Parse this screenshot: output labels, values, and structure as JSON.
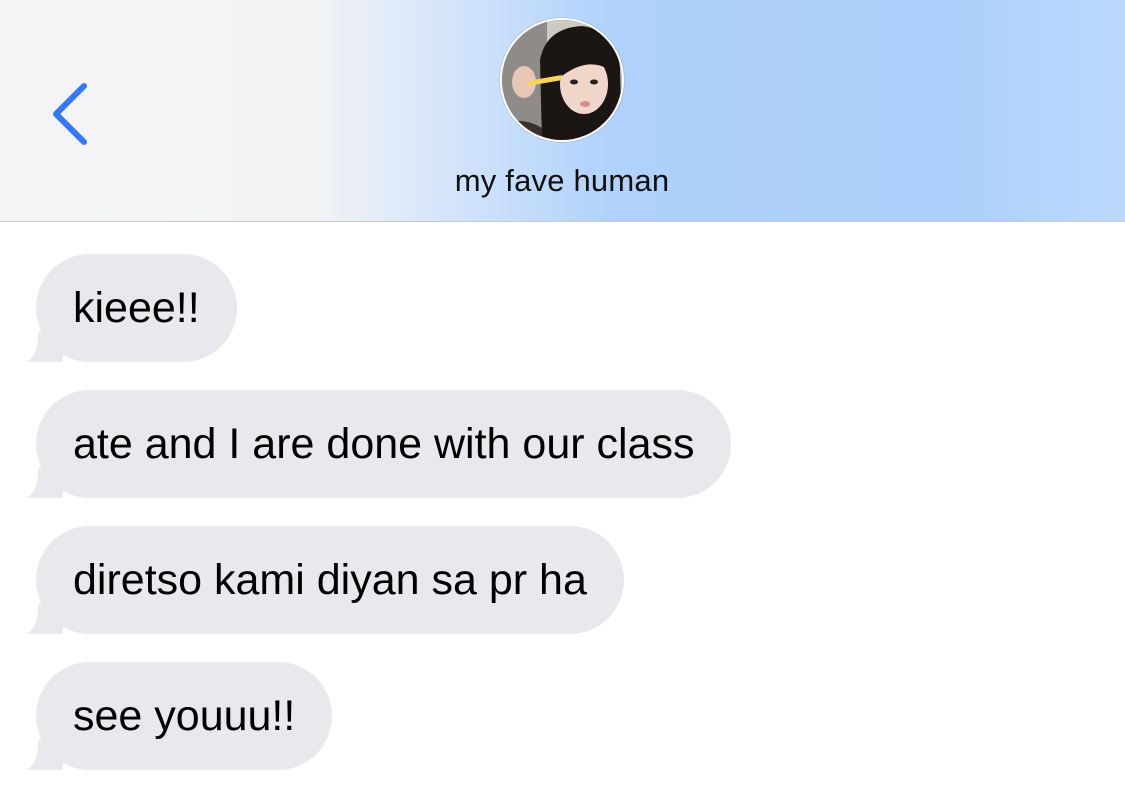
{
  "header": {
    "back_icon": "chevron-left-icon",
    "contact_name": "my fave human",
    "accent_color": "#3478f6"
  },
  "messages": [
    {
      "text": "kieee!!"
    },
    {
      "text": "ate and I are done with our class"
    },
    {
      "text": "diretso kami diyan sa pr ha"
    },
    {
      "text": "see youuu!!"
    }
  ],
  "colors": {
    "incoming_bubble": "#e8e8ed",
    "header_gradient_start": "#f4f4f6",
    "header_gradient_end": "#acd0fb"
  }
}
